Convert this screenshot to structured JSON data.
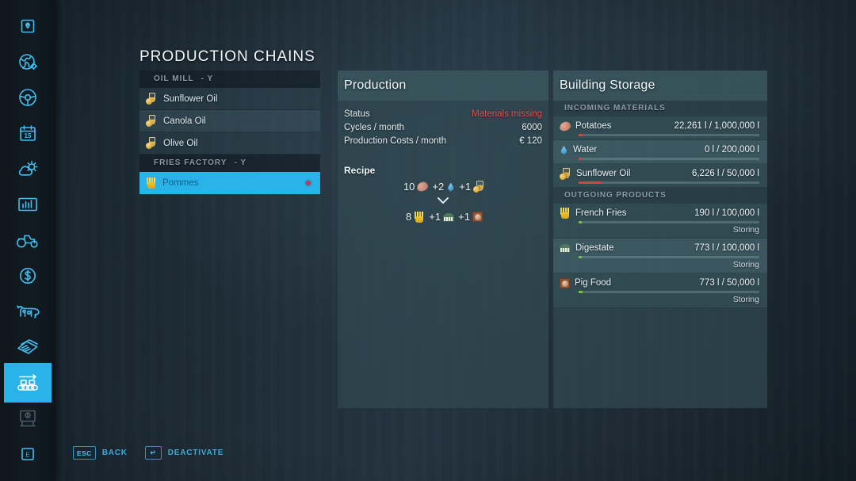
{
  "sidebar": {
    "items": [
      {
        "icon": "map-pin-boxed-icon",
        "label": "Map Overview",
        "active": false
      },
      {
        "icon": "globe-settings-icon",
        "label": "Game Settings",
        "active": false
      },
      {
        "icon": "steering-wheel-icon",
        "label": "Vehicle Control",
        "active": false
      },
      {
        "icon": "calendar-15-icon",
        "label": "Calendar",
        "active": false
      },
      {
        "icon": "weather-cloud-sun-icon",
        "label": "Weather",
        "active": false
      },
      {
        "icon": "bar-chart-icon",
        "label": "Statistics",
        "active": false
      },
      {
        "icon": "tractor-icon",
        "label": "Vehicles",
        "active": false
      },
      {
        "icon": "dollar-circle-icon",
        "label": "Finances",
        "active": false
      },
      {
        "icon": "cow-icon",
        "label": "Animals",
        "active": false
      },
      {
        "icon": "contracts-papers-icon",
        "label": "Contracts",
        "active": false
      },
      {
        "icon": "production-conveyor-icon",
        "label": "Production Chains",
        "active": true
      },
      {
        "icon": "easel-board-icon",
        "label": "Info Board",
        "active": false
      },
      {
        "icon": "key-e-icon",
        "label": "Key E",
        "active": false
      }
    ]
  },
  "page": {
    "title": "PRODUCTION CHAINS"
  },
  "chain_list": {
    "groups": [
      {
        "name": "OIL MILL",
        "key": "- Y",
        "items": [
          {
            "icon": "oil-flask-icon",
            "label": "Sunflower Oil",
            "selected": false,
            "alert": false
          },
          {
            "icon": "oil-flask-icon",
            "label": "Canola Oil",
            "selected": false,
            "alert": false
          },
          {
            "icon": "oil-flask-icon",
            "label": "Olive Oil",
            "selected": false,
            "alert": false
          }
        ]
      },
      {
        "name": "FRIES FACTORY",
        "key": "- Y",
        "items": [
          {
            "icon": "fries-icon",
            "label": "Pommes",
            "selected": true,
            "alert": true
          }
        ]
      }
    ]
  },
  "production": {
    "title": "Production",
    "stats": [
      {
        "label": "Status",
        "value": "Materials missing",
        "warn": true
      },
      {
        "label": "Cycles / month",
        "value": "6000",
        "warn": false
      },
      {
        "label": "Production Costs / month",
        "value": "€ 120",
        "warn": false
      }
    ],
    "recipe_label": "Recipe",
    "recipe_inputs": [
      {
        "amount": "10",
        "icon": "potato-icon"
      },
      {
        "amount": "+2",
        "icon": "water-icon"
      },
      {
        "amount": "+1",
        "icon": "oil-flask-icon"
      }
    ],
    "recipe_outputs": [
      {
        "amount": "8",
        "icon": "fries-icon"
      },
      {
        "amount": "+1",
        "icon": "digestate-icon"
      },
      {
        "amount": "+1",
        "icon": "pigfood-icon"
      }
    ]
  },
  "storage": {
    "title": "Building Storage",
    "sections": [
      {
        "header": "INCOMING MATERIALS",
        "rows": [
          {
            "icon": "potato-icon",
            "name": "Potatoes",
            "amount": "22,261 l / 1,000,000 l",
            "fill_pct": 2.2,
            "fill_color": "red",
            "status": ""
          },
          {
            "icon": "water-icon",
            "name": "Water",
            "amount": "0 l / 200,000 l",
            "fill_pct": 1.5,
            "fill_color": "red",
            "status": ""
          },
          {
            "icon": "oil-flask-icon",
            "name": "Sunflower Oil",
            "amount": "6,226 l / 50,000 l",
            "fill_pct": 12.5,
            "fill_color": "red",
            "status": ""
          }
        ]
      },
      {
        "header": "OUTGOING PRODUCTS",
        "rows": [
          {
            "icon": "fries-icon",
            "name": "French Fries",
            "amount": "190 l / 100,000 l",
            "fill_pct": 1.6,
            "fill_color": "green",
            "status": "Storing"
          },
          {
            "icon": "digestate-icon",
            "name": "Digestate",
            "amount": "773 l / 100,000 l",
            "fill_pct": 1.6,
            "fill_color": "green",
            "status": "Storing"
          },
          {
            "icon": "pigfood-icon",
            "name": "Pig Food",
            "amount": "773 l / 50,000 l",
            "fill_pct": 2.0,
            "fill_color": "green",
            "status": "Storing"
          }
        ]
      }
    ]
  },
  "footer": {
    "hints": [
      {
        "key": "ESC",
        "label": "BACK"
      },
      {
        "key": "↵",
        "label": "DEACTIVATE"
      }
    ]
  },
  "colors": {
    "accent": "#29b3e8",
    "accent_icon": "#3fc0ef",
    "warn": "#e04f4f",
    "bar_red": "#d8453f",
    "bar_green": "#77c242",
    "panel_bg": "#314a52",
    "alert_dot": "#c23a52"
  }
}
